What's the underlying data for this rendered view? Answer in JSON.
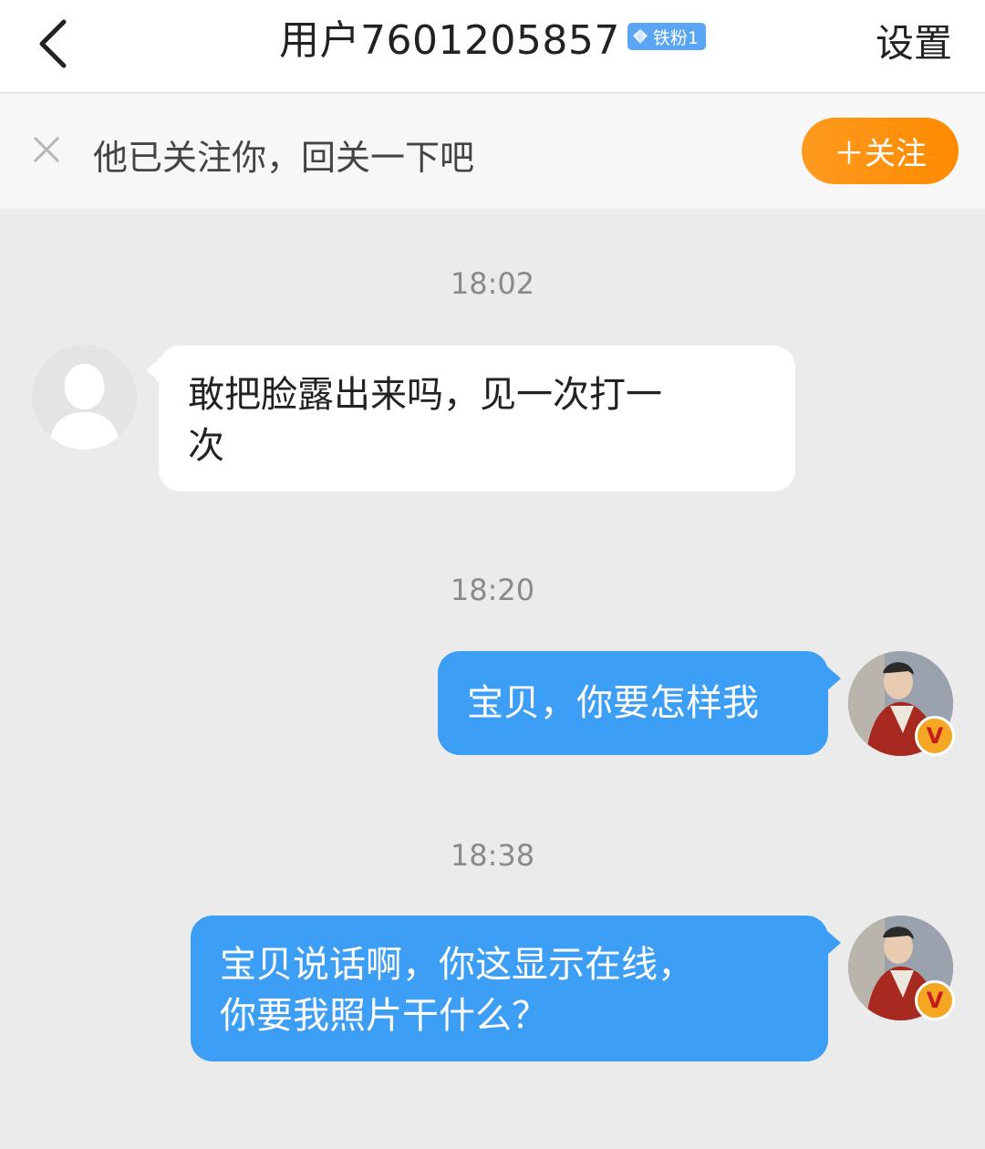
{
  "header": {
    "title": "用户7601205857",
    "fan_badge": "铁粉1",
    "settings_label": "设置"
  },
  "follow_bar": {
    "text": "他已关注你，回关一下吧",
    "button_label": "＋关注"
  },
  "messages": [
    {
      "time": "18:02",
      "direction": "incoming",
      "lines": [
        "敢把脸露出来吗，见一次打一",
        "次"
      ]
    },
    {
      "time": "18:20",
      "direction": "outgoing",
      "lines": [
        "宝贝，你要怎样我"
      ]
    },
    {
      "time": "18:38",
      "direction": "outgoing",
      "lines": [
        "宝贝说话啊，你这显示在线，",
        "你要我照片干什么？"
      ]
    }
  ],
  "colors": {
    "outgoing_bubble": "#3d9ef5",
    "follow_button": "#ff8a00",
    "fan_badge": "#5aa6f5"
  },
  "icons": [
    "back-icon",
    "diamond-icon",
    "close-icon",
    "default-avatar-icon",
    "verified-v-icon"
  ]
}
